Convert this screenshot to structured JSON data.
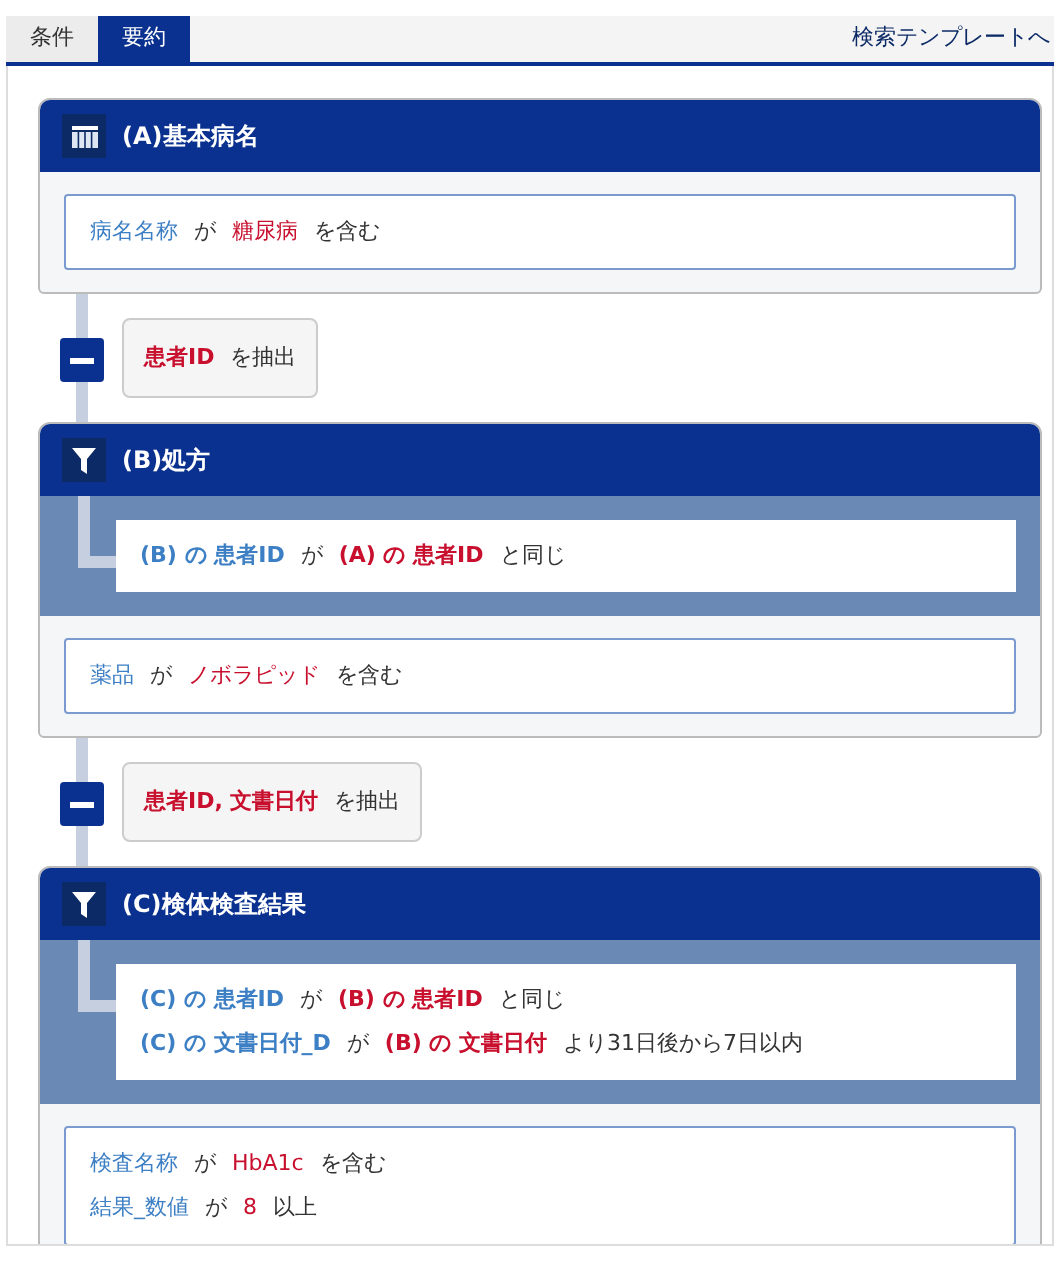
{
  "tabs": [
    {
      "label": "条件",
      "selected": false
    },
    {
      "label": "要約",
      "selected": true
    }
  ],
  "template_link": "検索テンプレートへ",
  "steps": [
    {
      "kind": "source",
      "title": "(A)基本病名",
      "conditions": [
        [
          {
            "kind": "field",
            "text": "病名名称"
          },
          {
            "kind": "op",
            "text": "が"
          },
          {
            "kind": "value",
            "text": "糖尿病"
          },
          {
            "kind": "op",
            "text": "を含む"
          }
        ]
      ]
    },
    {
      "kind": "extract",
      "parts": [
        {
          "kind": "value",
          "text": "患者ID"
        },
        {
          "kind": "op",
          "text": "を抽出"
        }
      ]
    },
    {
      "kind": "filter",
      "title": "(B)処方",
      "joins": [
        [
          {
            "kind": "field",
            "text": "(B) の 患者ID"
          },
          {
            "kind": "op",
            "text": "が"
          },
          {
            "kind": "value",
            "text": "(A) の 患者ID"
          },
          {
            "kind": "op",
            "text": "と同じ"
          }
        ]
      ],
      "conditions": [
        [
          {
            "kind": "field",
            "text": "薬品"
          },
          {
            "kind": "op",
            "text": "が"
          },
          {
            "kind": "value",
            "text": "ノボラピッド"
          },
          {
            "kind": "op",
            "text": "を含む"
          }
        ]
      ]
    },
    {
      "kind": "extract",
      "parts": [
        {
          "kind": "value",
          "text": "患者ID, 文書日付"
        },
        {
          "kind": "op",
          "text": "を抽出"
        }
      ]
    },
    {
      "kind": "filter",
      "title": "(C)検体検査結果",
      "joins": [
        [
          {
            "kind": "field",
            "text": "(C) の 患者ID"
          },
          {
            "kind": "op",
            "text": "が"
          },
          {
            "kind": "value",
            "text": "(B) の 患者ID"
          },
          {
            "kind": "op",
            "text": "と同じ"
          }
        ],
        [
          {
            "kind": "field",
            "text": "(C) の 文書日付_D"
          },
          {
            "kind": "op",
            "text": "が"
          },
          {
            "kind": "value",
            "text": "(B) の 文書日付"
          },
          {
            "kind": "op",
            "text": "より31日後から7日以内"
          }
        ]
      ],
      "conditions": [
        [
          {
            "kind": "field",
            "text": "検査名称"
          },
          {
            "kind": "op",
            "text": "が"
          },
          {
            "kind": "value",
            "text": "HbA1c"
          },
          {
            "kind": "op",
            "text": "を含む"
          }
        ],
        [
          {
            "kind": "field",
            "text": "結果_数値"
          },
          {
            "kind": "op",
            "text": "が"
          },
          {
            "kind": "value",
            "text": "8"
          },
          {
            "kind": "op",
            "text": "以上"
          }
        ]
      ]
    }
  ]
}
